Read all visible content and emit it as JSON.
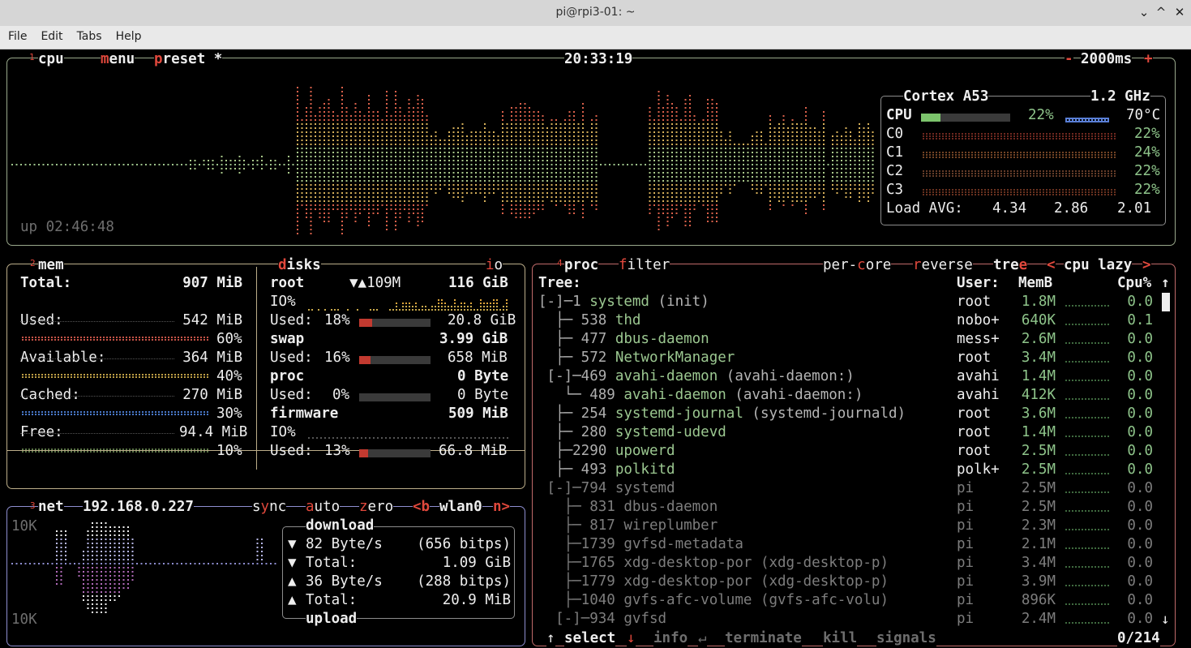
{
  "window": {
    "title": "pi@rpi3-01: ~",
    "buttons": [
      "⌄",
      "^",
      "✕"
    ]
  },
  "menu": [
    "File",
    "Edit",
    "Tabs",
    "Help"
  ],
  "cpu_box": {
    "num": "1",
    "title": "cpu",
    "menu": "menu",
    "preset": "preset *",
    "clock": "20:33:19",
    "interval": "2000ms",
    "minus": "-",
    "plus": "+",
    "uptime": "up 02:46:48",
    "model": "Cortex A53",
    "freq": "1.2 GHz",
    "cpu_label": "CPU",
    "cpu_pct": "22%",
    "cpu_value": 0.22,
    "temp": "70°C",
    "cores": [
      {
        "label": "C0",
        "pct": "22%"
      },
      {
        "label": "C1",
        "pct": "24%"
      },
      {
        "label": "C2",
        "pct": "22%"
      },
      {
        "label": "C3",
        "pct": "22%"
      }
    ],
    "load_label": "Load AVG:",
    "load": [
      "4.34",
      "2.86",
      "2.01"
    ]
  },
  "mem_box": {
    "num": "2",
    "title": "mem",
    "rows": [
      {
        "label": "Total:",
        "value": "907 MiB",
        "pct": ""
      },
      {
        "label": "Used:",
        "value": "542 MiB",
        "pct": "60%"
      },
      {
        "label": "Available:",
        "value": "364 MiB",
        "pct": "40%"
      },
      {
        "label": "Cached:",
        "value": "270 MiB",
        "pct": "30%"
      },
      {
        "label": "Free:",
        "value": "94.4 MiB",
        "pct": "10%"
      }
    ]
  },
  "disks_box": {
    "title": "disks",
    "io": "io",
    "root": {
      "name": "root",
      "speed": "▼▲109M",
      "size": "116 GiB",
      "io_label": "IO%",
      "used_label": "Used:",
      "used_pct": "18%",
      "used_val": "20.8 GiB",
      "fraction": 0.18
    },
    "swap": {
      "name": "swap",
      "size": "3.99 GiB",
      "used_label": "Used:",
      "used_pct": "16%",
      "used_val": "658 MiB",
      "fraction": 0.16
    },
    "proc": {
      "name": "proc",
      "size": "0 Byte",
      "used_label": "Used:",
      "used_pct": "0%",
      "used_val": "0 Byte",
      "fraction": 0.0
    },
    "firmware": {
      "name": "firmware",
      "size": "509 MiB",
      "io_label": "IO%",
      "used_label": "Used:",
      "used_pct": "13%",
      "used_val": "66.8 MiB",
      "fraction": 0.13
    }
  },
  "net_box": {
    "num": "3",
    "title": "net",
    "ip": "192.168.0.227",
    "sync": "sync",
    "auto": "auto",
    "zero": "zero",
    "prev": "<b",
    "iface": "wlan0",
    "next": "n>",
    "scale_top": "10K",
    "scale_bottom": "10K",
    "download_label": "download",
    "upload_label": "upload",
    "rows": [
      {
        "arrow": "▼",
        "label": "82 Byte/s",
        "value": "(656 bitps)"
      },
      {
        "arrow": "▼",
        "label": "Total:",
        "value": "1.09 GiB"
      },
      {
        "arrow": "▲",
        "label": "36 Byte/s",
        "value": "(288 bitps)"
      },
      {
        "arrow": "▲",
        "label": "Total:",
        "value": "20.9 MiB"
      }
    ]
  },
  "proc_box": {
    "num": "4",
    "title": "proc",
    "filter": "filter",
    "percore": "per-core",
    "reverse": "reverse",
    "tree": "tree",
    "prev": "<",
    "sort": "cpu lazy",
    "next": ">",
    "headers": {
      "tree": "Tree:",
      "user": "User:",
      "mem": "MemB",
      "cpu": "Cpu%",
      "sort_arrow": "↑"
    },
    "rows": [
      {
        "prefix": "[-]─1 ",
        "name": "systemd",
        "args": " (init)",
        "user": "root",
        "mem": "1.8M",
        "cpu": "0.0",
        "dim": false
      },
      {
        "prefix": "  ├─ 538 ",
        "name": "thd",
        "args": "",
        "user": "nobo+",
        "mem": "640K",
        "cpu": "0.1",
        "dim": false
      },
      {
        "prefix": "  ├─ 477 ",
        "name": "dbus-daemon",
        "args": "",
        "user": "mess+",
        "mem": "2.6M",
        "cpu": "0.0",
        "dim": false
      },
      {
        "prefix": "  ├─ 572 ",
        "name": "NetworkManager",
        "args": "",
        "user": "root",
        "mem": "3.4M",
        "cpu": "0.0",
        "dim": false
      },
      {
        "prefix": " [-]─469 ",
        "name": "avahi-daemon",
        "args": " (avahi-daemon:)",
        "user": "avahi",
        "mem": "1.4M",
        "cpu": "0.0",
        "dim": false
      },
      {
        "prefix": "   └─ 489 ",
        "name": "avahi-daemon",
        "args": " (avahi-daemon:)",
        "user": "avahi",
        "mem": "412K",
        "cpu": "0.0",
        "dim": false
      },
      {
        "prefix": "  ├─ 254 ",
        "name": "systemd-journal",
        "args": " (systemd-journald)",
        "user": "root",
        "mem": "3.6M",
        "cpu": "0.0",
        "dim": false
      },
      {
        "prefix": "  ├─ 280 ",
        "name": "systemd-udevd",
        "args": "",
        "user": "root",
        "mem": "1.4M",
        "cpu": "0.0",
        "dim": false
      },
      {
        "prefix": "  ├─2290 ",
        "name": "upowerd",
        "args": "",
        "user": "root",
        "mem": "2.5M",
        "cpu": "0.0",
        "dim": false
      },
      {
        "prefix": "  ├─ 493 ",
        "name": "polkitd",
        "args": "",
        "user": "polk+",
        "mem": "2.5M",
        "cpu": "0.0",
        "dim": false
      },
      {
        "prefix": " [-]─794 ",
        "name": "systemd",
        "args": "",
        "user": "pi",
        "mem": "2.5M",
        "cpu": "0.0",
        "dim": true
      },
      {
        "prefix": "   ├─ 831 ",
        "name": "dbus-daemon",
        "args": "",
        "user": "pi",
        "mem": "2.5M",
        "cpu": "0.0",
        "dim": true
      },
      {
        "prefix": "   ├─ 817 ",
        "name": "wireplumber",
        "args": "",
        "user": "pi",
        "mem": "2.3M",
        "cpu": "0.0",
        "dim": true
      },
      {
        "prefix": "   ├─1739 ",
        "name": "gvfsd-metadata",
        "args": "",
        "user": "pi",
        "mem": "2.1M",
        "cpu": "0.0",
        "dim": true
      },
      {
        "prefix": "   ├─1765 ",
        "name": "xdg-desktop-por",
        "args": " (xdg-desktop-p)",
        "user": "pi",
        "mem": "3.4M",
        "cpu": "0.0",
        "dim": true
      },
      {
        "prefix": "   ├─1779 ",
        "name": "xdg-desktop-por",
        "args": " (xdg-desktop-p)",
        "user": "pi",
        "mem": "3.9M",
        "cpu": "0.0",
        "dim": true
      },
      {
        "prefix": "   ├─1040 ",
        "name": "gvfs-afc-volume",
        "args": " (gvfs-afc-volu)",
        "user": "pi",
        "mem": "896K",
        "cpu": "0.0",
        "dim": true
      },
      {
        "prefix": "  [-]─934 ",
        "name": "gvfsd",
        "args": "",
        "user": "pi",
        "mem": "2.4M",
        "cpu": "0.0",
        "dim": true
      }
    ],
    "footer": {
      "up": "↑",
      "select": "select",
      "down": "↓",
      "info": "info",
      "enter": "↵",
      "terminate": "terminate",
      "kill": "kill",
      "signals": "signals",
      "count": "0/214"
    }
  },
  "colors": {
    "cpu_border": "#9aa98c",
    "mem_border": "#bcae8a",
    "disk_border": "#bcae8a",
    "net_border": "#8e8ed0",
    "proc_border": "#c06a6a",
    "accent_red": "#e0483c"
  }
}
